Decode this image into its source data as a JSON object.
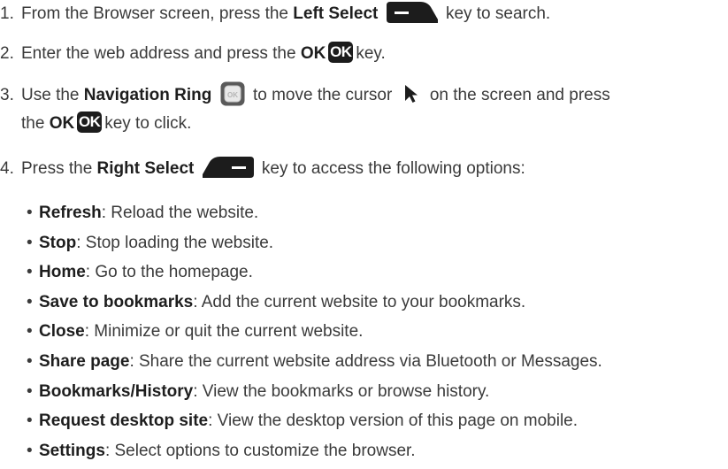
{
  "steps": [
    {
      "num": "1.",
      "pre": "From the Browser screen, press the",
      "key": "Left Select",
      "post": "key to search."
    },
    {
      "num": "2.",
      "pre": "Enter the web address and press the",
      "key": "OK",
      "key_glyph": "OK",
      "post": "key."
    },
    {
      "num": "3.",
      "pre": "Use the",
      "key": "Navigation Ring",
      "nav_glyph": "OK",
      "mid": "to move the cursor",
      "post": "on the screen and press",
      "line2_pre": "the",
      "key2": "OK",
      "key2_glyph": "OK",
      "line2_post": "key to click."
    },
    {
      "num": "4.",
      "pre": "Press the",
      "key": "Right Select",
      "post": "key to access the following options:"
    }
  ],
  "options": [
    {
      "term": "Refresh",
      "desc": ": Reload the website."
    },
    {
      "term": "Stop",
      "desc": ": Stop loading the website."
    },
    {
      "term": "Home",
      "desc": ": Go to the homepage."
    },
    {
      "term": "Save to bookmarks",
      "desc": ": Add the current website to your bookmarks."
    },
    {
      "term": "Close",
      "desc": ": Minimize or quit the current website."
    },
    {
      "term": "Share page",
      "desc": ": Share the current website address via Bluetooth or Messages."
    },
    {
      "term": "Bookmarks/History",
      "desc": ": View the bookmarks or browse history."
    },
    {
      "term": "Request desktop site",
      "desc": ": View the desktop version of this page on mobile."
    },
    {
      "term": "Settings",
      "desc": ": Select options to customize the browser."
    }
  ],
  "bullet_glyph": "•",
  "icons": {
    "left_select": "left-select-key-icon",
    "right_select": "right-select-key-icon",
    "ok": "ok-key-icon",
    "navigation_ring": "navigation-ring-icon",
    "cursor": "cursor-arrow-icon"
  },
  "colors": {
    "text": "#3a3a3a",
    "key": "#1c1c1c"
  }
}
